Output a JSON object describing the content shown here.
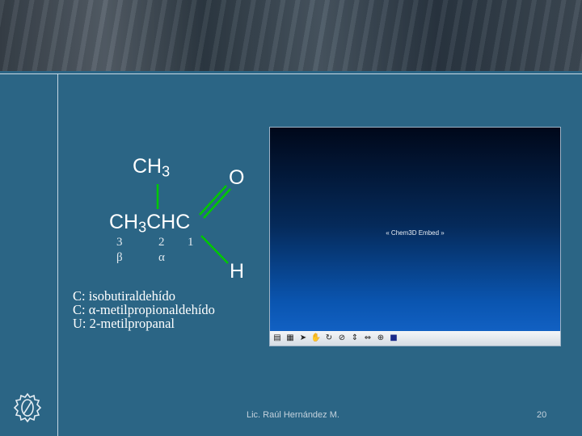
{
  "structure": {
    "methyl_top": {
      "base": "CH",
      "sub": "3"
    },
    "carbonyl_O": "O",
    "main_chain": {
      "part1": "CH",
      "sub": "3",
      "part2": "CHC"
    },
    "aldehyde_H": "H",
    "bond_color": "#00c800",
    "carbon_numbers": [
      "3",
      "2",
      "1"
    ],
    "greek_labels": [
      "β",
      "α"
    ]
  },
  "names": [
    "C: isobutiraldehído",
    "C: α-metilpropionaldehído",
    "U: 2-metilpropanal"
  ],
  "embed": {
    "label": "« Chem3D Embed »",
    "toolbar_icons": [
      "file-icon",
      "grid-icon",
      "arrow-cursor-icon",
      "hand-icon",
      "rotate-icon",
      "zoom-icon",
      "translate-icon",
      "arrows-icon",
      "axis-icon",
      "stop-icon"
    ]
  },
  "footer": {
    "author": "Lic. Raúl Hernández M.",
    "page": "20"
  }
}
